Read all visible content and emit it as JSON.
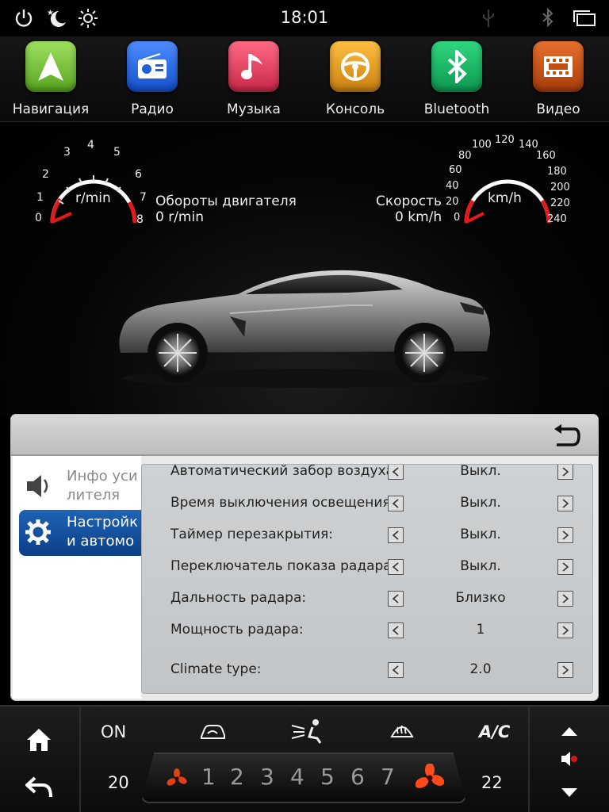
{
  "status_bar": {
    "time": "18:01"
  },
  "apps": [
    {
      "label": "Навигация",
      "icon": "navigation-arrow-icon",
      "color": "#7cc43c"
    },
    {
      "label": "Радио",
      "icon": "radio-icon",
      "color": "#2a6ee6"
    },
    {
      "label": "Музыка",
      "icon": "music-note-icon",
      "color": "#e04060"
    },
    {
      "label": "Консоль",
      "icon": "steering-wheel-icon",
      "color": "#e0a020"
    },
    {
      "label": "Bluetooth",
      "icon": "bluetooth-icon",
      "color": "#18b060"
    },
    {
      "label": "Видео",
      "icon": "film-icon",
      "color": "#c85010"
    }
  ],
  "dashboard": {
    "rpm_gauge": {
      "unit": "r/min",
      "title": "Обороты двигателя",
      "value_text": "0 r/min",
      "ticks": [
        "0",
        "1",
        "2",
        "3",
        "4",
        "5",
        "6",
        "7",
        "8"
      ],
      "value": 0
    },
    "speed_gauge": {
      "unit": "km/h",
      "title": "Скорость",
      "value_text": "0 km/h",
      "ticks": [
        "0",
        "20",
        "40",
        "60",
        "80",
        "100",
        "120",
        "140",
        "160",
        "180",
        "200",
        "220",
        "240"
      ],
      "value": 0
    }
  },
  "settings": {
    "sidebar": [
      {
        "label": "Инфо усилителя",
        "active": false
      },
      {
        "label": "Настройки автомо",
        "active": true
      }
    ],
    "rows": [
      {
        "label": "Автоматический забор воздуха:",
        "value": "Выкл."
      },
      {
        "label": "Время выключения освещения:",
        "value": "Выкл."
      },
      {
        "label": "Таймер перезакрытия:",
        "value": "Выкл."
      },
      {
        "label": "Переключатель показа радара:",
        "value": "Выкл."
      },
      {
        "label": "Дальность радара:",
        "value": "Близко"
      },
      {
        "label": "Мощность радара:",
        "value": "1"
      },
      {
        "label": "Climate type:",
        "value": "2.0"
      }
    ]
  },
  "climate": {
    "power": "ON",
    "ac": "A/C",
    "temp_left": "20",
    "temp_right": "22",
    "fan_levels": [
      "1",
      "2",
      "3",
      "4",
      "5",
      "6",
      "7"
    ]
  }
}
